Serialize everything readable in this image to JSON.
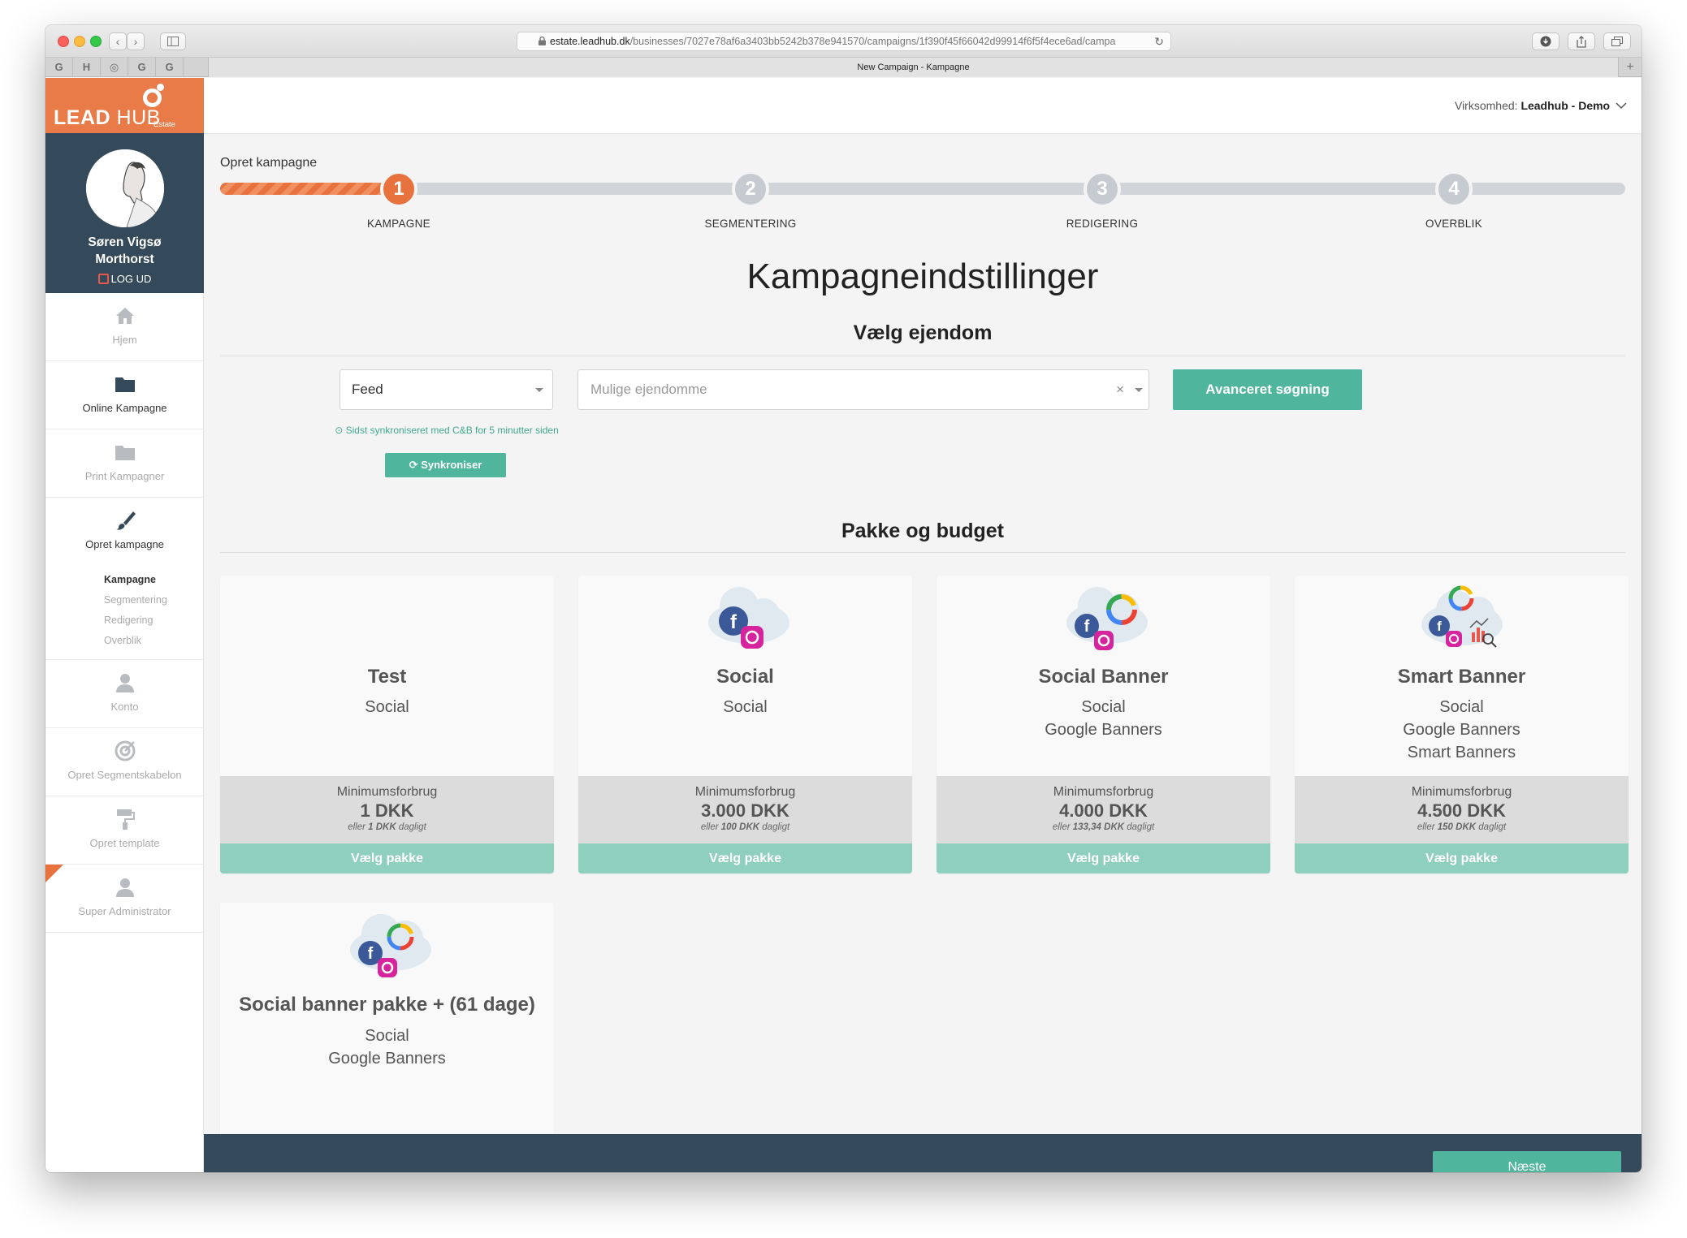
{
  "browser": {
    "url_host": "estate.leadhub.dk",
    "url_path": "/businesses/7027e78af6a3403bb5242b378e941570/campaigns/1f390f45f66042d99914f6f5f4ece6ad/campa",
    "tab_title": "New Campaign - Kampagne",
    "pinned_tabs": [
      "G",
      "H",
      "◎",
      "G",
      "G"
    ]
  },
  "brand": {
    "lead": "LEAD",
    "hub": "HUB",
    "sub": "Estate"
  },
  "user": {
    "name_line1": "Søren Vigsø",
    "name_line2": "Morthorst",
    "logout": "LOG UD"
  },
  "nav": {
    "home": "Hjem",
    "online": "Online Kampagne",
    "print": "Print Kampagner",
    "create": "Opret kampagne",
    "sub": [
      "Kampagne",
      "Segmentering",
      "Redigering",
      "Overblik"
    ],
    "account": "Konto",
    "segment_template": "Opret Segmentskabelon",
    "template": "Opret template",
    "admin": "Super Administrator"
  },
  "header": {
    "company_label": "Virksomhed:",
    "company_value": "Leadhub - Demo"
  },
  "breadcrumb": "Opret kampagne",
  "steps": [
    {
      "num": "1",
      "label": "KAMPAGNE"
    },
    {
      "num": "2",
      "label": "SEGMENTERING"
    },
    {
      "num": "3",
      "label": "REDIGERING"
    },
    {
      "num": "4",
      "label": "OVERBLIK"
    }
  ],
  "page_title": "Kampagneindstillinger",
  "property_section": "Vælg ejendom",
  "feed_select": "Feed",
  "property_placeholder": "Mulige ejendomme",
  "advanced_search": "Avanceret søgning",
  "sync_note": "Sidst synkroniseret med C&B for 5 minutter siden",
  "sync_button": "Synkroniser",
  "package_section": "Pakke og budget",
  "packages": [
    {
      "title": "Test",
      "channels": [
        "Social"
      ],
      "min_label": "Minimumsforbrug",
      "min_value": "1 DKK",
      "daily_pre": "eller",
      "daily_value": "1 DKK",
      "daily_post": "dagligt",
      "button": "Vælg pakke"
    },
    {
      "title": "Social",
      "channels": [
        "Social"
      ],
      "min_label": "Minimumsforbrug",
      "min_value": "3.000 DKK",
      "daily_pre": "eller",
      "daily_value": "100 DKK",
      "daily_post": "dagligt",
      "button": "Vælg pakke"
    },
    {
      "title": "Social Banner",
      "channels": [
        "Social",
        "Google Banners"
      ],
      "min_label": "Minimumsforbrug",
      "min_value": "4.000 DKK",
      "daily_pre": "eller",
      "daily_value": "133,34 DKK",
      "daily_post": "dagligt",
      "button": "Vælg pakke"
    },
    {
      "title": "Smart Banner",
      "channels": [
        "Social",
        "Google Banners",
        "Smart Banners"
      ],
      "min_label": "Minimumsforbrug",
      "min_value": "4.500 DKK",
      "daily_pre": "eller",
      "daily_value": "150 DKK",
      "daily_post": "dagligt",
      "button": "Vælg pakke"
    },
    {
      "title": "Social banner pakke + (61 dage)",
      "channels": [
        "Social",
        "Google Banners"
      ]
    }
  ],
  "next_button": "Næste",
  "colors": {
    "accent_orange": "#e8723e",
    "accent_green": "#4fb59c",
    "sidebar_dark": "#344a5a"
  }
}
